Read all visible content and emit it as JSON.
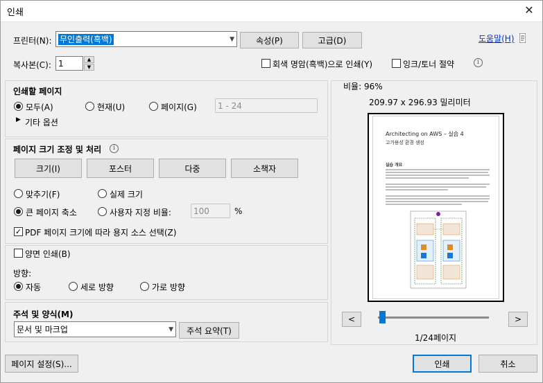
{
  "window": {
    "title": "인쇄",
    "close_glyph": "✕"
  },
  "printer": {
    "label": "프린터(N):",
    "selected": "무인출력(흑백)",
    "properties_button": "속성(P)",
    "advanced_button": "고급(D)",
    "help_link": "도움말(H)"
  },
  "copies": {
    "label": "복사본(C):",
    "value": "1",
    "grayscale_label": "회색 명암(흑백)으로 인쇄(Y)",
    "grayscale_checked": false,
    "save_ink_label": "잉크/토너 절약",
    "save_ink_checked": false
  },
  "pages_to_print": {
    "heading": "인쇄할 페이지",
    "all_label": "모두(A)",
    "current_label": "현재(U)",
    "pages_label": "페이지(G)",
    "pages_placeholder": "1 - 24",
    "more_options": "기타 옵션",
    "selected": "all"
  },
  "page_sizing": {
    "heading": "페이지 크기 조정 및 처리",
    "tabs": [
      "크기(I)",
      "포스터",
      "다중",
      "소책자"
    ],
    "fit_label": "맞추기(F)",
    "actual_size_label": "실제 크기",
    "shrink_label": "큰 페이지 축소",
    "custom_scale_label": "사용자 지정 비율:",
    "custom_scale_value": "100",
    "percent": "%",
    "pdf_source_label": "PDF 페이지 크기에 따라 용지 소스 선택(Z)",
    "pdf_source_checked": true,
    "selected": "shrink"
  },
  "duplex": {
    "label": "양면 인쇄(B)",
    "checked": false
  },
  "orientation": {
    "label": "방향:",
    "auto_label": "자동",
    "portrait_label": "세로 방향",
    "landscape_label": "가로 방향",
    "selected": "auto"
  },
  "comments": {
    "heading": "주석 및 양식(M)",
    "selected": "문서 및 마크업",
    "summary_button": "주석 요약(T)"
  },
  "preview": {
    "scale_label": "비율: 96%",
    "dimensions": "209.97 x 296.93 밀리미터",
    "page_title": "Architecting on AWS – 실습 4",
    "page_subtitle": "고가용성 환경 생성",
    "section_heading": "실습 개요",
    "page_indicator": "1/24페이지",
    "prev_glyph": "<",
    "next_glyph": ">"
  },
  "footer": {
    "page_setup_button": "페이지 설정(S)...",
    "print_button": "인쇄",
    "cancel_button": "취소"
  }
}
